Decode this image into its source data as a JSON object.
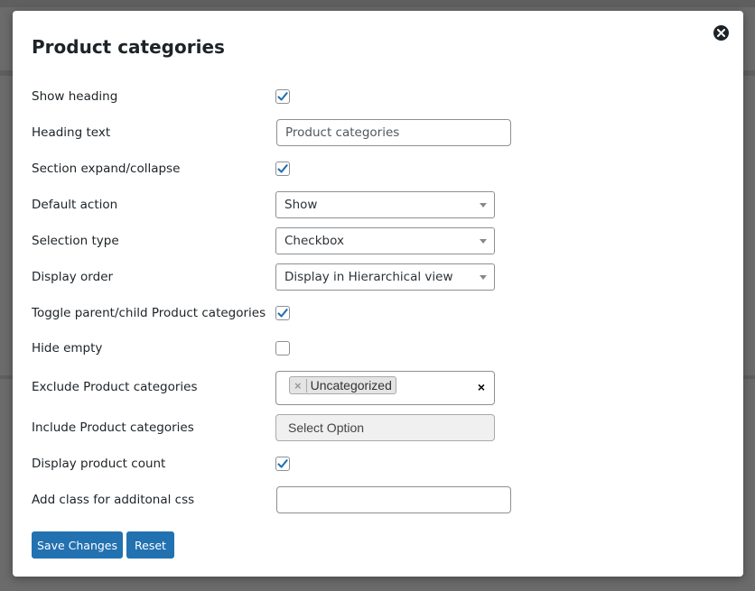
{
  "modal": {
    "title": "Product categories",
    "close_icon": "close-circle-icon"
  },
  "fields": {
    "show_heading": {
      "label": "Show heading",
      "checked": true
    },
    "heading_text": {
      "label": "Heading text",
      "value": "Product categories",
      "placeholder": ""
    },
    "section_expand": {
      "label": "Section expand/collapse",
      "checked": true
    },
    "default_action": {
      "label": "Default action",
      "value": "Show"
    },
    "selection_type": {
      "label": "Selection type",
      "value": "Checkbox"
    },
    "display_order": {
      "label": "Display order",
      "value": "Display in Hierarchical view"
    },
    "toggle_parent_child": {
      "label": "Toggle parent/child Product categories",
      "checked": true
    },
    "hide_empty": {
      "label": "Hide empty",
      "checked": false
    },
    "exclude_categories": {
      "label": "Exclude Product categories",
      "tags": [
        "Uncategorized"
      ],
      "remove_glyph": "×",
      "clear_glyph": "×"
    },
    "include_categories": {
      "label": "Include Product categories",
      "placeholder": "Select Option"
    },
    "display_product_count": {
      "label": "Display product count",
      "checked": true
    },
    "additional_css": {
      "label": "Add class for additonal css",
      "value": ""
    }
  },
  "buttons": {
    "save": "Save Changes",
    "reset": "Reset"
  },
  "colors": {
    "primary": "#2271b1",
    "checkmark": "#2271b1",
    "backdrop": "#6b6b6b"
  }
}
